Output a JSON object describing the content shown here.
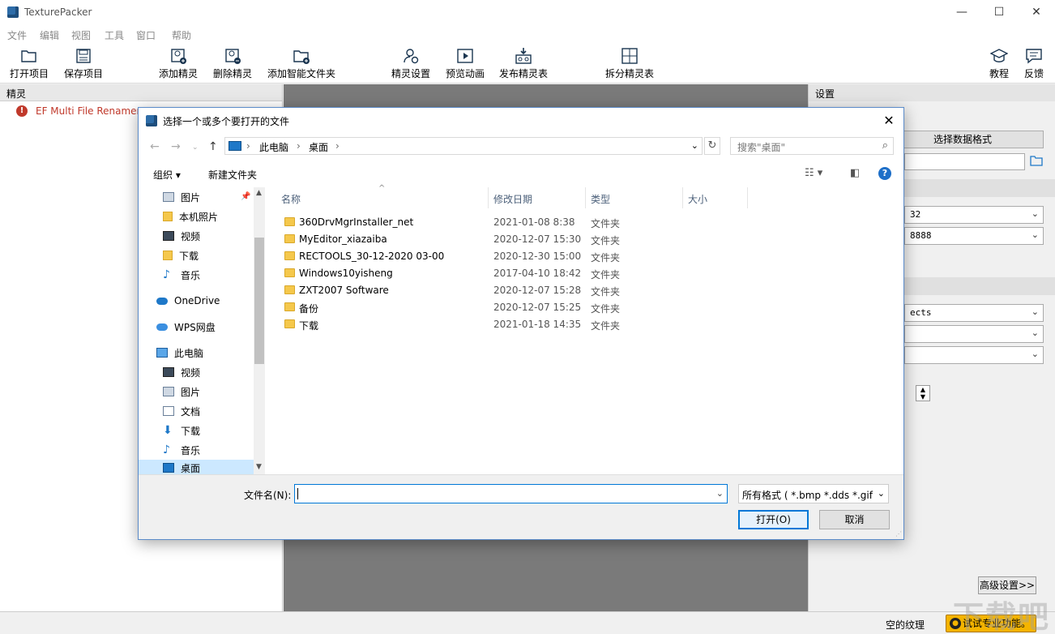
{
  "app": {
    "title": "TexturePacker",
    "window_controls": {
      "minimize": "—",
      "maximize": "☐",
      "close": "✕"
    }
  },
  "menu": [
    "文件",
    "编辑",
    "视图",
    "工具",
    "窗口",
    "帮助"
  ],
  "toolbar": [
    {
      "label": "打开项目",
      "icon": "folder-open-icon"
    },
    {
      "label": "保存项目",
      "icon": "save-icon"
    },
    {
      "label": "添加精灵",
      "icon": "add-sprite-icon"
    },
    {
      "label": "删除精灵",
      "icon": "remove-sprite-icon"
    },
    {
      "label": "添加智能文件夹",
      "icon": "add-smart-folder-icon"
    },
    {
      "label": "精灵设置",
      "icon": "sprite-settings-icon"
    },
    {
      "label": "预览动画",
      "icon": "preview-animation-icon"
    },
    {
      "label": "发布精灵表",
      "icon": "publish-icon"
    },
    {
      "label": "拆分精灵表",
      "icon": "split-icon"
    },
    {
      "label": "教程",
      "icon": "tutorial-icon"
    },
    {
      "label": "反馈",
      "icon": "feedback-icon"
    }
  ],
  "sprites_panel": {
    "header": "精灵",
    "items": [
      {
        "name": "EF Multi File Renamer",
        "status": "error"
      }
    ]
  },
  "settings_panel": {
    "header": "设置",
    "data_format_button": "选择数据格式",
    "select_values": [
      "32",
      "8888",
      "ects",
      "",
      ""
    ],
    "advanced_button": "高级设置>>"
  },
  "status": {
    "text": "空的纹理",
    "pro_button": "试试专业功能。"
  },
  "dialog": {
    "title": "选择一个或多个要打开的文件",
    "close": "✕",
    "breadcrumb": [
      "此电脑",
      "桌面"
    ],
    "search_placeholder": "搜索\"桌面\"",
    "commands": {
      "organize": "组织 ▾",
      "new_folder": "新建文件夹"
    },
    "nav_items": [
      {
        "label": "图片",
        "icon": "pictures-icon",
        "pinned": true
      },
      {
        "label": "本机照片",
        "icon": "folder-icon"
      },
      {
        "label": "视频",
        "icon": "video-icon"
      },
      {
        "label": "下载",
        "icon": "folder-icon"
      },
      {
        "label": "音乐",
        "icon": "music-icon"
      },
      {
        "label": "OneDrive",
        "icon": "cloud-icon"
      },
      {
        "label": "WPS网盘",
        "icon": "cloud-icon"
      },
      {
        "label": "此电脑",
        "icon": "pc-icon"
      },
      {
        "label": "视频",
        "icon": "video-icon"
      },
      {
        "label": "图片",
        "icon": "pictures-icon"
      },
      {
        "label": "文档",
        "icon": "documents-icon"
      },
      {
        "label": "下载",
        "icon": "download-icon"
      },
      {
        "label": "音乐",
        "icon": "music-icon"
      },
      {
        "label": "桌面",
        "icon": "desktop-icon",
        "selected": true
      }
    ],
    "columns": [
      "名称",
      "修改日期",
      "类型",
      "大小"
    ],
    "files": [
      {
        "name": "360DrvMgrInstaller_net",
        "date": "2021-01-08 8:38",
        "type": "文件夹"
      },
      {
        "name": "MyEditor_xiazaiba",
        "date": "2020-12-07 15:30",
        "type": "文件夹"
      },
      {
        "name": "RECTOOLS_30-12-2020 03-00",
        "date": "2020-12-30 15:00",
        "type": "文件夹"
      },
      {
        "name": "Windows10yisheng",
        "date": "2017-04-10 18:42",
        "type": "文件夹"
      },
      {
        "name": "ZXT2007 Software",
        "date": "2020-12-07 15:28",
        "type": "文件夹"
      },
      {
        "name": "备份",
        "date": "2020-12-07 15:25",
        "type": "文件夹"
      },
      {
        "name": "下载",
        "date": "2021-01-18 14:35",
        "type": "文件夹"
      }
    ],
    "filename_label": "文件名(N):",
    "filename_value": "",
    "filter": "所有格式 ( *.bmp *.dds *.gif *",
    "open_button": "打开(O)",
    "cancel_button": "取消"
  },
  "watermark": "下载吧"
}
